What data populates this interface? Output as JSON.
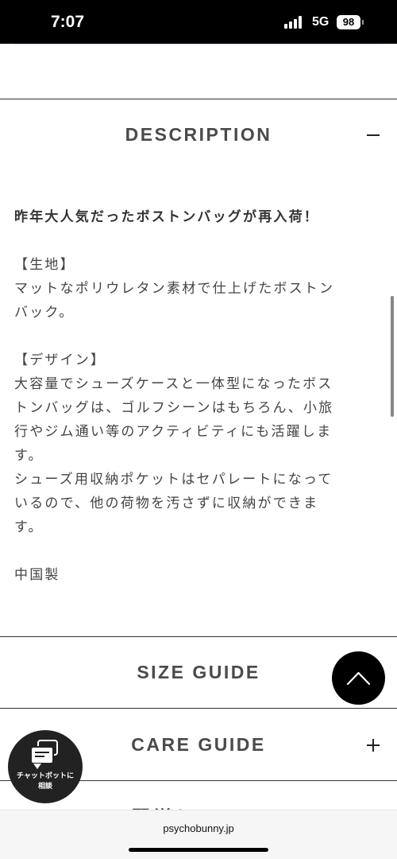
{
  "status_bar": {
    "time": "7:07",
    "network": "5G",
    "battery": "98"
  },
  "sections": {
    "description": {
      "title": "DESCRIPTION",
      "toggle": "minus-icon",
      "lead": "昨年大人気だったボストンバッグが再入荷！",
      "fabric_heading": "【生地】",
      "fabric_text": "マットなポリウレタン素材で仕上げたボストン\nバック。",
      "design_heading": "【デザイン】",
      "design_text_1": "大容量でシューズケースと一体型になったボス\nトンバッグは、ゴルフシーンはもちろん、小旅\n行やジム通い等のアクティビティにも活躍しま\nす。",
      "design_text_2": "シューズ用収納ポケットはセパレートになって\nいるので、他の荷物を汚さずに収納ができま\nす。",
      "origin": "中国製"
    },
    "size_guide": {
      "title": "SIZE GUIDE"
    },
    "care_guide": {
      "title": "CARE GUIDE",
      "toggle": "plus-icon"
    },
    "next_partial": {
      "title": "配送について"
    }
  },
  "floating": {
    "scroll_top": "chevron-up-icon",
    "chatbot_label": "チャットボットに\n相談",
    "chatbot_icon": "chat-bubble-icon"
  },
  "browser": {
    "url": "psychobunny.jp"
  },
  "colors": {
    "dark": "#000000",
    "text": "#444444",
    "chat_button": "#222222"
  }
}
